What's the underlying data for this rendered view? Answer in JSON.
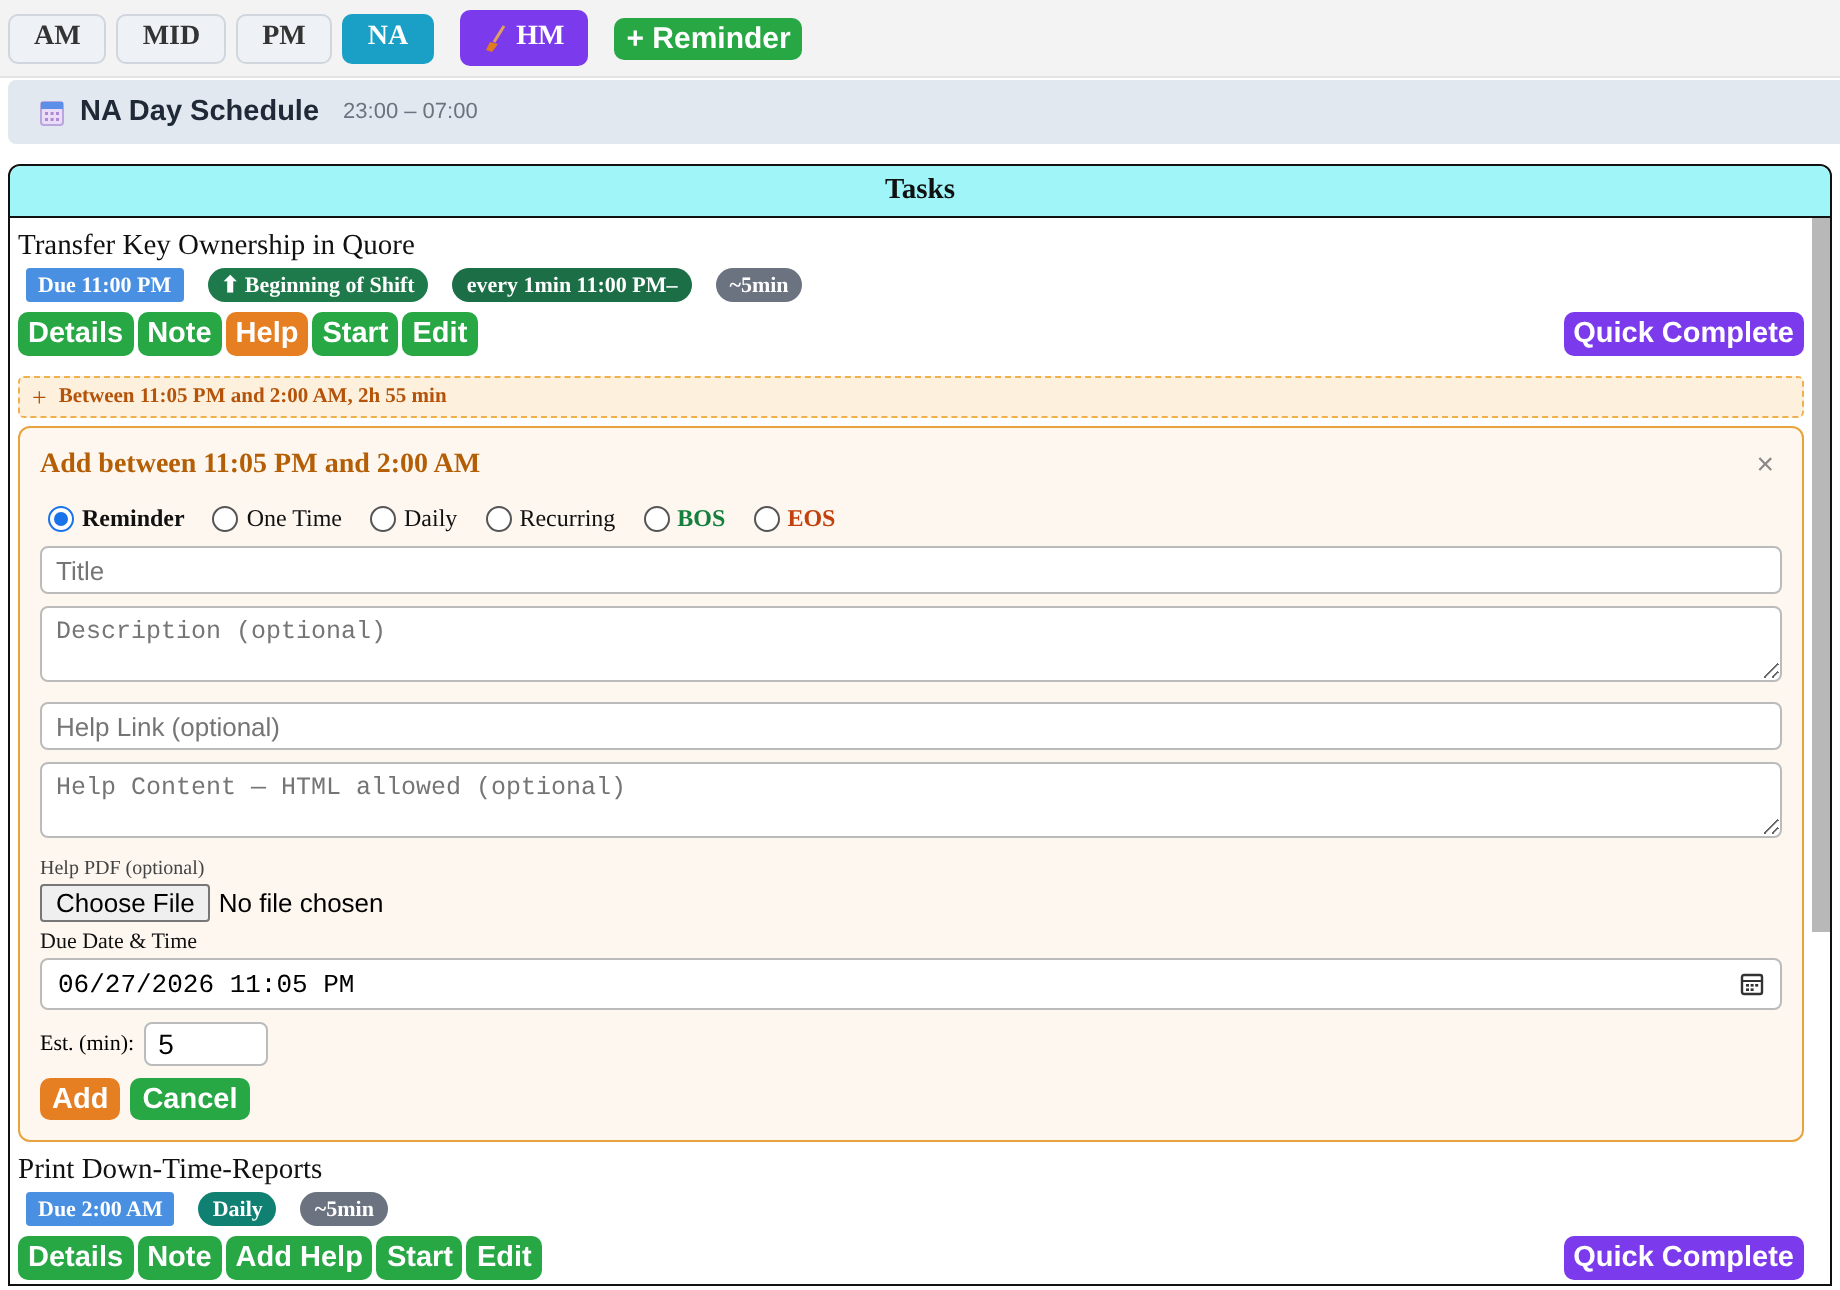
{
  "shift_tabs": [
    {
      "label": "AM",
      "selected": false
    },
    {
      "label": "MID",
      "selected": false
    },
    {
      "label": "PM",
      "selected": false
    },
    {
      "label": "NA",
      "selected": true
    }
  ],
  "hm_button": {
    "label": "HM"
  },
  "reminder_button": {
    "label": "+ Reminder"
  },
  "schedule": {
    "title": "NA Day Schedule",
    "hours": "23:00 – 07:00"
  },
  "tasks_panel": {
    "title": "Tasks",
    "items": [
      {
        "kind": "task",
        "title": "Transfer Key Ownership in Quore",
        "badges": [
          {
            "kind": "due",
            "text": "Due 11:00 PM"
          },
          {
            "kind": "bos",
            "text": "⬆ Beginning of Shift"
          },
          {
            "kind": "recurring",
            "text": "every 1min 11:00 PM–"
          },
          {
            "kind": "estimate",
            "text": "~5min"
          }
        ],
        "actions": [
          {
            "kind": "plain",
            "label": "Details"
          },
          {
            "kind": "plain",
            "label": "Note"
          },
          {
            "kind": "help",
            "label": "Help"
          },
          {
            "kind": "plain",
            "label": "Start"
          },
          {
            "kind": "plain",
            "label": "Edit"
          }
        ],
        "quick_complete": "Quick Complete"
      },
      {
        "kind": "gap",
        "marker": "+",
        "text": "Between 11:05 PM and 2:00 AM, 2h 55 min",
        "expanded": true
      },
      {
        "kind": "form",
        "title": "Add between 11:05 PM and 2:00 AM",
        "close": "×",
        "types": [
          {
            "kind": "plain",
            "label": "Reminder",
            "selected": true
          },
          {
            "kind": "plain",
            "label": "One Time",
            "selected": false
          },
          {
            "kind": "plain",
            "label": "Daily",
            "selected": false
          },
          {
            "kind": "plain",
            "label": "Recurring",
            "selected": false
          },
          {
            "kind": "bos",
            "label": "BOS",
            "selected": false
          },
          {
            "kind": "eos",
            "label": "EOS",
            "selected": false
          }
        ],
        "title_field": {
          "placeholder": "Title"
        },
        "description_field": {
          "placeholder": "Description (optional)"
        },
        "help_link_field": {
          "placeholder": "Help Link (optional)"
        },
        "help_content_field": {
          "placeholder": "Help Content — HTML allowed (optional)"
        },
        "help_pdf": {
          "label": "Help PDF (optional)",
          "button": "Choose File",
          "status": "No file chosen"
        },
        "due": {
          "label": "Due Date & Time",
          "value": "06/27/2026 11:05 PM"
        },
        "estimate": {
          "label": "Est. (min):",
          "value": "5"
        },
        "buttons": [
          {
            "kind": "add",
            "label": "Add"
          },
          {
            "kind": "cancel",
            "label": "Cancel"
          }
        ]
      },
      {
        "kind": "task",
        "title": "Print Down-Time-Reports",
        "badges": [
          {
            "kind": "due",
            "text": "Due 2:00 AM"
          },
          {
            "kind": "daily",
            "text": "Daily"
          },
          {
            "kind": "estimate",
            "text": "~5min"
          }
        ],
        "actions": [
          {
            "kind": "plain",
            "label": "Details"
          },
          {
            "kind": "plain",
            "label": "Note"
          },
          {
            "kind": "plain",
            "label": "Add Help"
          },
          {
            "kind": "plain",
            "label": "Start"
          },
          {
            "kind": "plain",
            "label": "Edit"
          }
        ],
        "quick_complete": "Quick Complete"
      }
    ]
  }
}
